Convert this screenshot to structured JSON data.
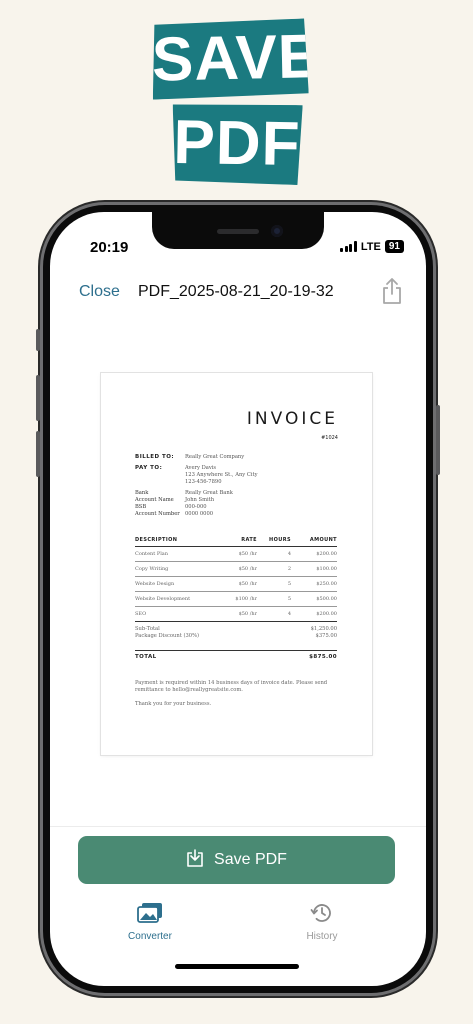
{
  "headline": {
    "line1": "SAVE",
    "line2": "PDF"
  },
  "status": {
    "time": "20:19",
    "network": "LTE",
    "battery": "91"
  },
  "nav": {
    "close_label": "Close",
    "title": "PDF_2025-08-21_20-19-32"
  },
  "invoice": {
    "title": "INVOICE",
    "number": "#1024",
    "billed_to_label": "BILLED TO:",
    "billed_to_value": "Really Great Company",
    "pay_to_label": "PAY TO:",
    "pay_to_name": "Avery Davis",
    "pay_to_address": "123 Anywhere St., Any City",
    "pay_to_phone": "123-456-7890",
    "bank_label": "Bank",
    "bank_value": "Really Great Bank",
    "account_name_label": "Account Name",
    "account_name_value": "John Smith",
    "bsb_label": "BSB",
    "bsb_value": "000-000",
    "account_number_label": "Account Number",
    "account_number_value": "0000 0000",
    "columns": [
      "DESCRIPTION",
      "RATE",
      "HOURS",
      "AMOUNT"
    ],
    "rows": [
      [
        "Content Plan",
        "$50 /hr",
        "4",
        "$200.00"
      ],
      [
        "Copy Writing",
        "$50 /hr",
        "2",
        "$100.00"
      ],
      [
        "Website Design",
        "$50 /hr",
        "5",
        "$250.00"
      ],
      [
        "Website Development",
        "$100 /hr",
        "5",
        "$500.00"
      ],
      [
        "SEO",
        "$50 /hr",
        "4",
        "$200.00"
      ]
    ],
    "subtotal_label": "Sub-Total",
    "subtotal_value": "$1,250.00",
    "discount_label": "Package Discount (30%)",
    "discount_value": "$375.00",
    "total_label": "TOTAL",
    "total_value": "$875.00",
    "note": "Payment is required within 14 business days of invoice date. Please send remittance to hello@reallygreatsite.com.",
    "thanks": "Thank you for your business."
  },
  "save_button": {
    "label": "Save PDF",
    "color": "#4a8a73"
  },
  "tabs": [
    {
      "label": "Converter",
      "icon": "images-icon",
      "active": true
    },
    {
      "label": "History",
      "icon": "history-icon",
      "active": false
    }
  ],
  "colors": {
    "accent": "#2d6f8d",
    "headline_bg": "#1b7a80",
    "page_bg": "#f8f4ec"
  }
}
